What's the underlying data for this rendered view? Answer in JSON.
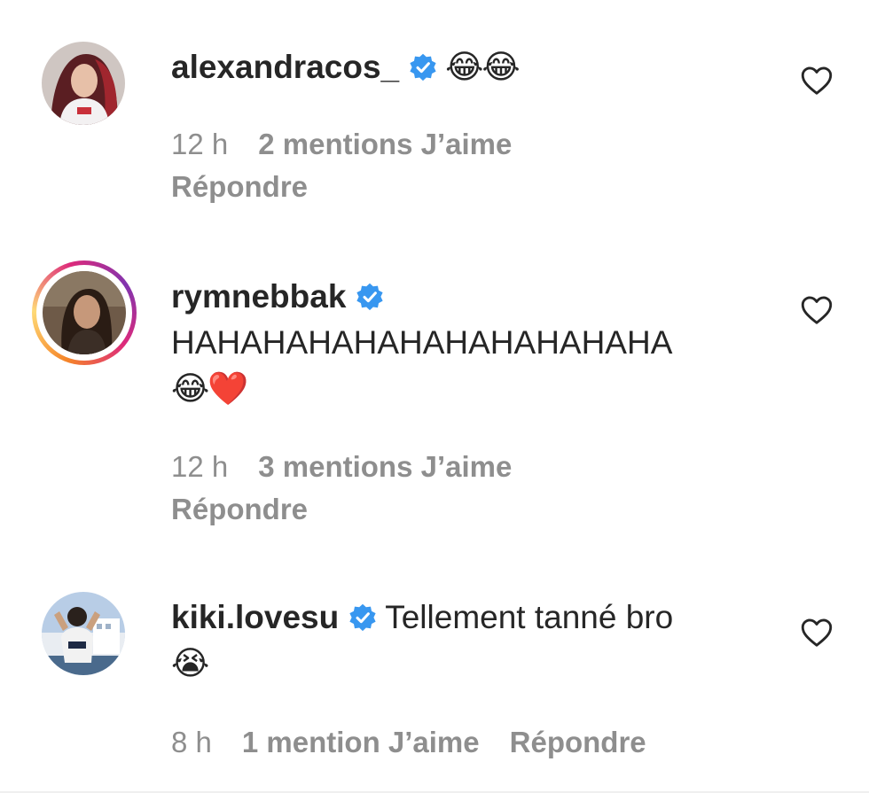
{
  "comments": [
    {
      "username": "alexandracos_",
      "verified": true,
      "text": "😂😂",
      "time": "12 h",
      "likes": "2 mentions J’aime",
      "reply": "Répondre",
      "avatar": "avatar-woman-red-hair",
      "has_story_ring": false
    },
    {
      "username": "rymnebbak",
      "verified": true,
      "text": "HAHAHAHAHAHAHAHAHAHAHA",
      "text_line2": "😂❤️",
      "time": "12 h",
      "likes": "3 mentions J’aime",
      "reply": "Répondre",
      "avatar": "avatar-woman-portrait",
      "has_story_ring": true
    },
    {
      "username": "kiki.lovesu",
      "verified": true,
      "text": "Tellement tanné bro",
      "text_line2": "😭",
      "time": "8 h",
      "likes": "1 mention J’aime",
      "reply": "Répondre",
      "avatar": "avatar-person-outdoors",
      "has_story_ring": false
    }
  ],
  "icons": {
    "verified": "verified-badge-icon",
    "like": "heart-outline-icon"
  },
  "colors": {
    "verified_blue": "#3897f0",
    "meta_gray": "#8e8e8e",
    "text": "#262626"
  }
}
